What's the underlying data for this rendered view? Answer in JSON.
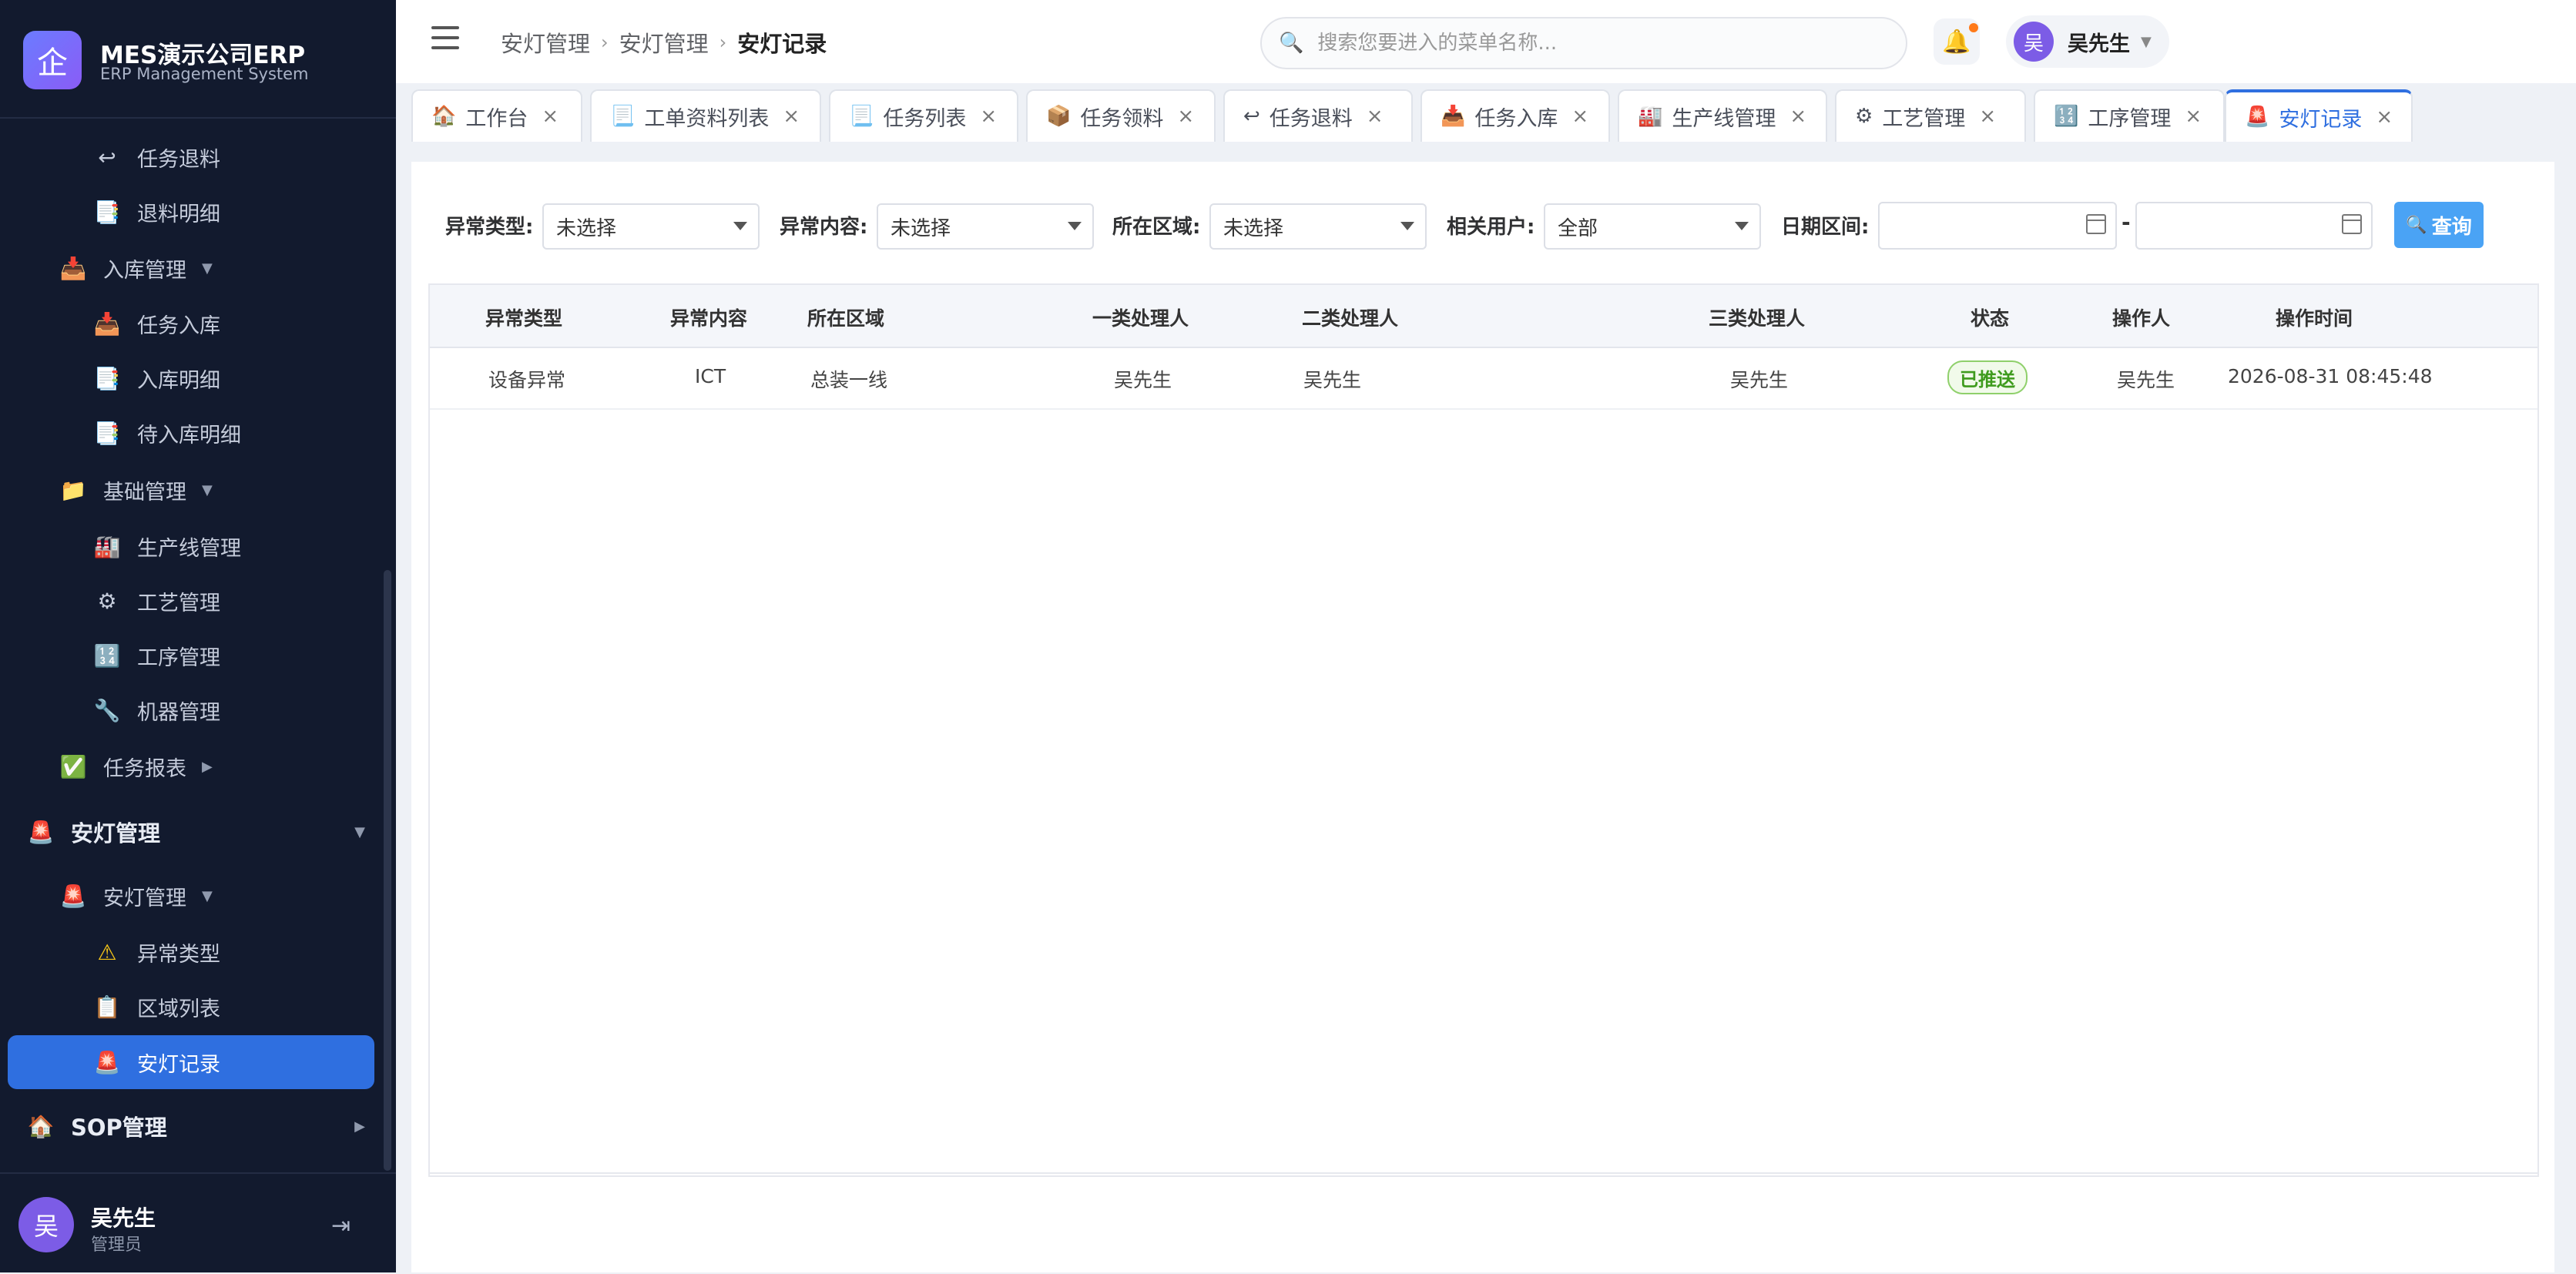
{
  "brand": {
    "logo": "企",
    "title": "MES演示公司ERP",
    "subtitle": "ERP Management System"
  },
  "sidebar": {
    "items": [
      {
        "label": "任务退料",
        "icon": "↩"
      },
      {
        "label": "退料明细",
        "icon": "📑"
      },
      {
        "label": "入库管理",
        "icon": "📥"
      },
      {
        "label": "任务入库",
        "icon": "📥"
      },
      {
        "label": "入库明细",
        "icon": "📑"
      },
      {
        "label": "待入库明细",
        "icon": "📑"
      },
      {
        "label": "基础管理",
        "icon": "📁"
      },
      {
        "label": "生产线管理",
        "icon": "🏭"
      },
      {
        "label": "工艺管理",
        "icon": "⚙"
      },
      {
        "label": "工序管理",
        "icon": "🔢"
      },
      {
        "label": "机器管理",
        "icon": "🔧"
      },
      {
        "label": "任务报表",
        "icon": "✅"
      },
      {
        "label": "安灯管理",
        "icon": "🚨"
      },
      {
        "label": "安灯管理",
        "icon": "🚨"
      },
      {
        "label": "异常类型",
        "icon": "⚠"
      },
      {
        "label": "区域列表",
        "icon": "📋"
      },
      {
        "label": "安灯记录",
        "icon": "🚨"
      },
      {
        "label": "SOP管理",
        "icon": "🏠"
      }
    ],
    "arrows": {
      "down": "▼",
      "right": "▶"
    },
    "user": {
      "avatar": "吴",
      "name": "吴先生",
      "role": "管理员"
    }
  },
  "header": {
    "breadcrumb": [
      "安灯管理",
      "安灯管理",
      "安灯记录"
    ],
    "breadcrumb_sep": "›",
    "search_placeholder": "搜索您要进入的菜单名称...",
    "user": {
      "avatar": "吴",
      "name": "吴先生"
    }
  },
  "tabs": [
    {
      "label": "工作台",
      "icon": "🏠"
    },
    {
      "label": "工单资料列表",
      "icon": "📃"
    },
    {
      "label": "任务列表",
      "icon": "📃"
    },
    {
      "label": "任务领料",
      "icon": "📦"
    },
    {
      "label": "任务退料",
      "icon": "↩"
    },
    {
      "label": "任务入库",
      "icon": "📥"
    },
    {
      "label": "生产线管理",
      "icon": "🏭"
    },
    {
      "label": "工艺管理",
      "icon": "⚙"
    },
    {
      "label": "工序管理",
      "icon": "🔢"
    },
    {
      "label": "安灯记录",
      "icon": "🚨"
    }
  ],
  "tab_close": "×",
  "filters": {
    "type": {
      "label": "异常类型:",
      "value": "未选择"
    },
    "content": {
      "label": "异常内容:",
      "value": "未选择"
    },
    "area": {
      "label": "所在区域:",
      "value": "未选择"
    },
    "user": {
      "label": "相关用户:",
      "value": "全部"
    },
    "date": {
      "label": "日期区间:",
      "start": "",
      "end": "",
      "sep": "-"
    },
    "query_label": "查询",
    "query_icon": "🔍"
  },
  "table": {
    "columns": [
      "异常类型",
      "异常内容",
      "所在区域",
      "一类处理人",
      "二类处理人",
      "三类处理人",
      "状态",
      "操作人",
      "操作时间"
    ],
    "rows": [
      {
        "type": "设备异常",
        "content": "ICT",
        "area": "总装一线",
        "handler1": "吴先生",
        "handler2": "吴先生",
        "handler3": "吴先生",
        "status": "已推送",
        "operator": "吴先生",
        "time": "2026-08-31 08:45:48"
      }
    ]
  },
  "colors": {
    "sidebar_bg": "#121a2e",
    "accent": "#2f6fe0",
    "query_btn": "#4aa3f5",
    "status_green": "#3f9b1e"
  }
}
